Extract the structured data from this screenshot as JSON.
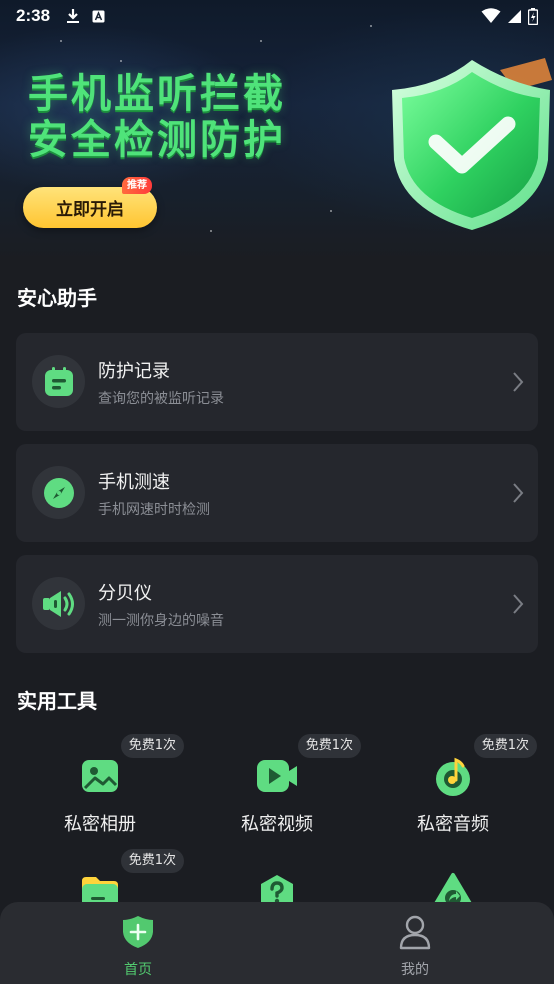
{
  "status_bar": {
    "time": "2:38",
    "icons": [
      "download-icon",
      "a-notification-icon",
      "wifi-icon",
      "signal-icon",
      "battery-icon"
    ]
  },
  "hero": {
    "title_line1": "手机监听拦截",
    "title_line2": "安全检测防护",
    "start_button": "立即开启",
    "badge": "推荐"
  },
  "assistant": {
    "section_title": "安心助手",
    "items": [
      {
        "title": "防护记录",
        "desc": "查询您的被监听记录",
        "icon": "record-icon"
      },
      {
        "title": "手机测速",
        "desc": "手机网速时时检测",
        "icon": "speed-compass-icon"
      },
      {
        "title": "分贝仪",
        "desc": "测一测你身边的噪音",
        "icon": "speaker-icon"
      }
    ]
  },
  "tools": {
    "section_title": "实用工具",
    "items": [
      {
        "label": "私密相册",
        "badge": "免费1次",
        "icon": "photo-album-icon"
      },
      {
        "label": "私密视频",
        "badge": "免费1次",
        "icon": "video-icon"
      },
      {
        "label": "私密音频",
        "badge": "免费1次",
        "icon": "music-icon"
      },
      {
        "label": "",
        "badge": "免费1次",
        "icon": "folder-icon"
      },
      {
        "label": "",
        "badge": "",
        "icon": "help-hexagon-icon"
      },
      {
        "label": "",
        "badge": "",
        "icon": "share-triangle-icon"
      }
    ]
  },
  "bottom_nav": {
    "items": [
      {
        "label": "首页",
        "icon": "shield-plus-icon",
        "active": true
      },
      {
        "label": "我的",
        "icon": "person-icon",
        "active": false
      }
    ]
  },
  "colors": {
    "accent_green": "#4fe37a",
    "button_yellow": "#ffc531",
    "card_bg": "#25272d",
    "page_bg": "#1b1d22"
  }
}
